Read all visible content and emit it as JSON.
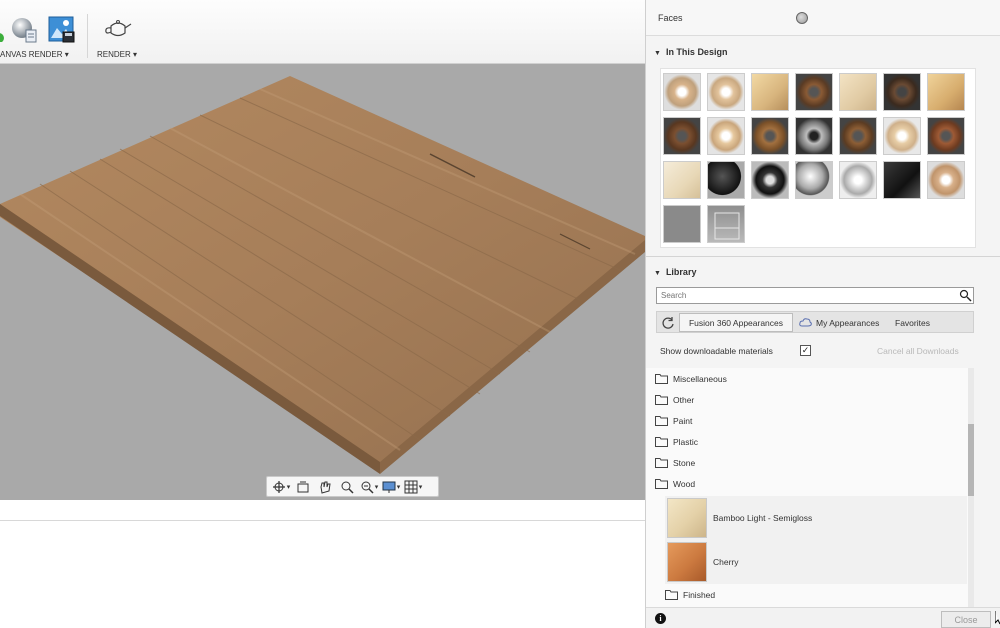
{
  "toolbar": {
    "canvas_render_label": "ANVAS RENDER ▾",
    "render_label": "RENDER ▾"
  },
  "panel": {
    "faces_label": "Faces",
    "in_this_design_header": "In This Design",
    "library_header": "Library",
    "search_placeholder": "Search",
    "tabs": {
      "fusion": "Fusion 360 Appearances",
      "my": "My Appearances",
      "favorites": "Favorites"
    },
    "show_downloadable_label": "Show downloadable materials",
    "show_downloadable_checked": true,
    "cancel_downloads_label": "Cancel all Downloads",
    "folders": [
      "Miscellaneous",
      "Other",
      "Paint",
      "Plastic",
      "Stone",
      "Wood"
    ],
    "materials": [
      {
        "name": "Bamboo Light - Semigloss"
      },
      {
        "name": "Cherry"
      }
    ],
    "sub_folder": "Finished",
    "close_label": "Close"
  },
  "icons": {
    "toolbar": [
      "sphere-icon",
      "canvas-render-icon",
      "teapot-icon"
    ],
    "nav": [
      "orbit-icon",
      "look-at-icon",
      "pan-icon",
      "zoom-icon",
      "fit-icon",
      "display-settings-icon",
      "grid-icon"
    ]
  },
  "colors": {
    "viewport_bg": "#a9a9a9",
    "wood": "#a47c57",
    "panel_bg": "#f4f4f4"
  }
}
